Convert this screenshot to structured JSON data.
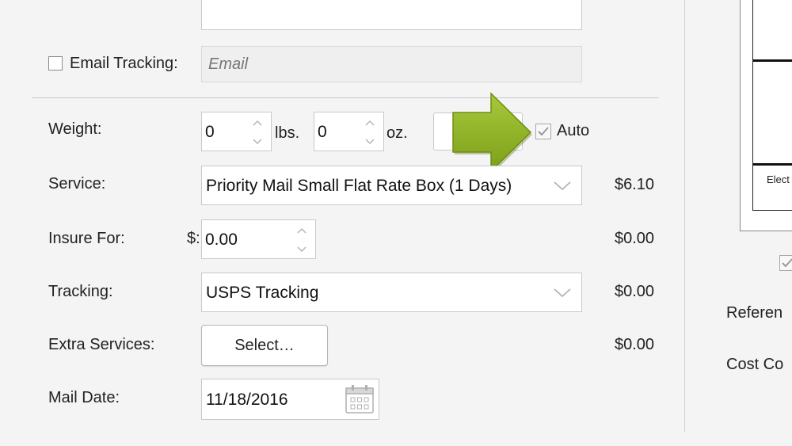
{
  "form": {
    "email_tracking": {
      "label": "Email Tracking:",
      "checked": false,
      "placeholder": "Email",
      "value": ""
    },
    "weight": {
      "label": "Weight:",
      "lbs_value": "0",
      "lbs_unit": "lbs.",
      "oz_value": "0",
      "oz_unit": "oz.",
      "auto_label": "Auto",
      "auto_checked": true
    },
    "service": {
      "label": "Service:",
      "value": "Priority Mail Small Flat Rate Box (1 Days)",
      "price": "$6.10"
    },
    "insure": {
      "label": "Insure For:",
      "currency": "$:",
      "value": "0.00",
      "price": "$0.00"
    },
    "tracking": {
      "label": "Tracking:",
      "value": "USPS Tracking",
      "price": "$0.00"
    },
    "extra_services": {
      "label": "Extra Services:",
      "button_label": "Select…",
      "price": "$0.00"
    },
    "mail_date": {
      "label": "Mail Date:",
      "value": "11/18/2016"
    }
  },
  "right_panel": {
    "label_preview_partial": "Elect",
    "reference_label": "Referen",
    "cost_code_label": "Cost Co"
  },
  "colors": {
    "arrow": "#8db21f",
    "arrow_dark": "#6b8a14",
    "background": "#f4f4f4"
  },
  "icons": [
    "checkbox-icon",
    "spinner-icon",
    "chevron-down-icon",
    "calendar-icon",
    "arrow-icon"
  ]
}
